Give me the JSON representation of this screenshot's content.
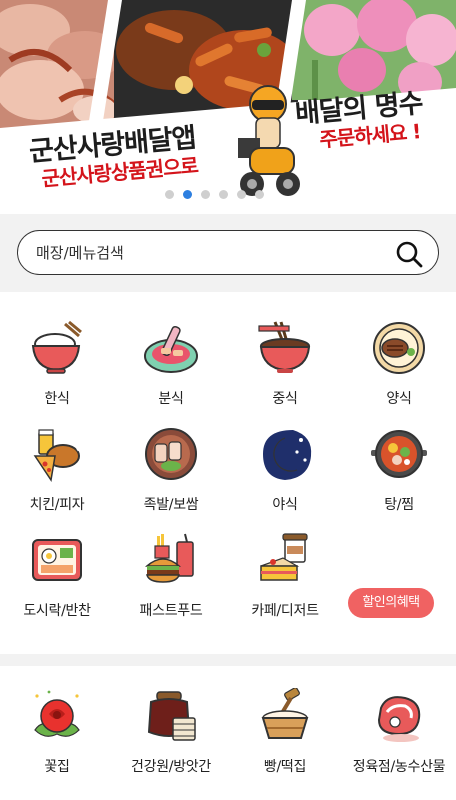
{
  "banner": {
    "line1": "군산사랑배달앱",
    "line2": "군산사랑상품권으로",
    "line3": "배달의 명수",
    "line4": "주문하세요 !",
    "dot_count": 6,
    "active_dot": 1
  },
  "search": {
    "placeholder": "매장/메뉴검색"
  },
  "categories": [
    {
      "label": "한식",
      "icon": "rice-bowl-icon"
    },
    {
      "label": "분식",
      "icon": "tteokbokki-icon"
    },
    {
      "label": "중식",
      "icon": "noodle-bowl-icon"
    },
    {
      "label": "양식",
      "icon": "steak-plate-icon"
    },
    {
      "label": "치킨/피자",
      "icon": "chicken-pizza-icon"
    },
    {
      "label": "족발/보쌈",
      "icon": "pork-plate-icon"
    },
    {
      "label": "야식",
      "icon": "crescent-moon-icon"
    },
    {
      "label": "탕/찜",
      "icon": "hot-pot-icon"
    },
    {
      "label": "도시락/반찬",
      "icon": "lunchbox-icon"
    },
    {
      "label": "패스트푸드",
      "icon": "burger-fries-icon"
    },
    {
      "label": "카페/디저트",
      "icon": "coffee-cake-icon"
    }
  ],
  "discount_button": "할인의혜택",
  "categories2": [
    {
      "label": "꽃집",
      "icon": "rose-icon"
    },
    {
      "label": "건강원/방앗간",
      "icon": "honey-jar-icon"
    },
    {
      "label": "빵/떡집",
      "icon": "mortar-icon"
    },
    {
      "label": "정육점/농수산물",
      "icon": "meat-icon"
    }
  ],
  "colors": {
    "accent_blue": "#2d7fe0",
    "discount_red": "#f06262",
    "banner_red": "#d4141b",
    "section_gray": "#f2f2f2"
  }
}
